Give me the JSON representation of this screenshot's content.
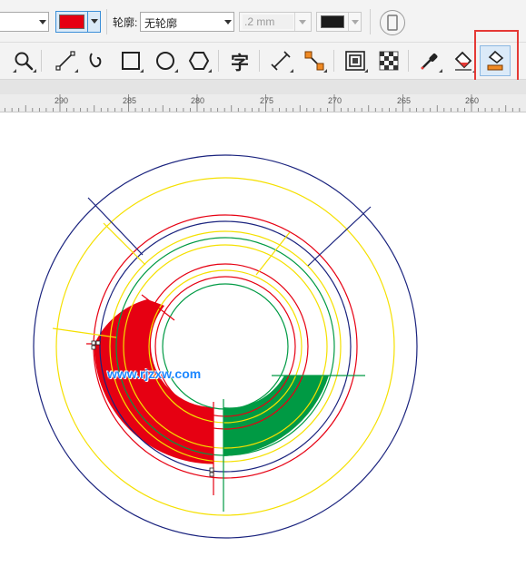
{
  "property_bar": {
    "fill_color": "#e60012",
    "outline_label": "轮廓:",
    "outline_value": "无轮廓",
    "outline_width_value": ".2 mm",
    "outline_color": "#1a1a1a"
  },
  "toolbar": {
    "tools": [
      {
        "name": "zoom-tool-icon"
      },
      {
        "name": "freehand-tool-icon"
      },
      {
        "name": "bspline-tool-icon"
      },
      {
        "name": "rectangle-tool-icon"
      },
      {
        "name": "ellipse-tool-icon"
      },
      {
        "name": "polygon-tool-icon"
      },
      {
        "name": "text-tool-icon",
        "glyph": "字"
      },
      {
        "name": "dimension-tool-icon"
      },
      {
        "name": "connector-tool-icon"
      },
      {
        "name": "contour-tool-icon"
      },
      {
        "name": "transparency-tool-icon"
      },
      {
        "name": "eyedropper-tool-icon"
      },
      {
        "name": "interactive-fill-tool-icon"
      },
      {
        "name": "smart-fill-tool-icon",
        "highlighted": true
      }
    ],
    "highlight_color": "#e53935"
  },
  "ruler": {
    "labels": [
      "290",
      "285",
      "280",
      "275",
      "270",
      "265",
      "260"
    ]
  },
  "canvas": {
    "watermark": "www.rjzxw.com",
    "colors": {
      "navy": "#1a237e",
      "yellow": "#f5e000",
      "red": "#e60012",
      "green": "#009a44"
    }
  }
}
